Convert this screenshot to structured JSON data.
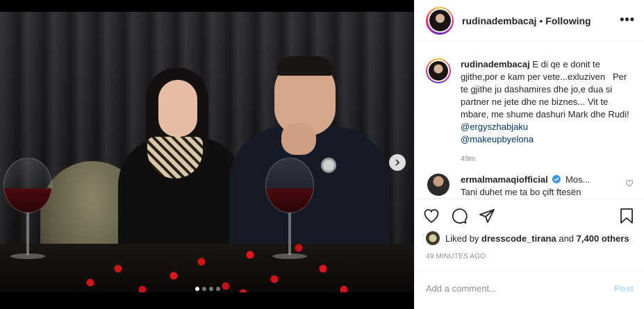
{
  "post": {
    "username": "rudinadembacaj",
    "follow_separator": "•",
    "follow_status": "Following",
    "more_label": "•••"
  },
  "caption": {
    "username": "rudinadembacaj",
    "text_1": " E di qe e donit te gjithe,por e kam per vete...exluziven   Per te gjithe ju dashamires dhe jo,e dua si partner ne jete dhe ne biznes... Vit te mbare, me shume dashuri Mark dhe Rudi! ",
    "mention_1": "@ergyszhabjaku",
    "mention_2": "@makeupbyelona",
    "time": "49m"
  },
  "comment": {
    "username": "ermalmamaqiofficial",
    "text_1": "Mos...",
    "text_2": "Tani duhet me ta bo çift ftesën"
  },
  "likes": {
    "prefix": "Liked by",
    "liker": "dresscode_tirana",
    "connector": "and",
    "others": "7,400 others"
  },
  "posted_ago": "49 minutes ago",
  "add_comment": {
    "placeholder": "Add a comment...",
    "post_label": "Post"
  },
  "carousel": {
    "total": 4,
    "current": 1
  },
  "colors": {
    "link": "#003569",
    "verified": "#3897f0",
    "post_disabled": "#b2dffc",
    "meta_gray": "#8e8e8e"
  },
  "icons": [
    "heart-icon",
    "comment-icon",
    "share-icon",
    "bookmark-icon",
    "chevron-right-icon",
    "verified-icon",
    "heart-small-icon"
  ]
}
